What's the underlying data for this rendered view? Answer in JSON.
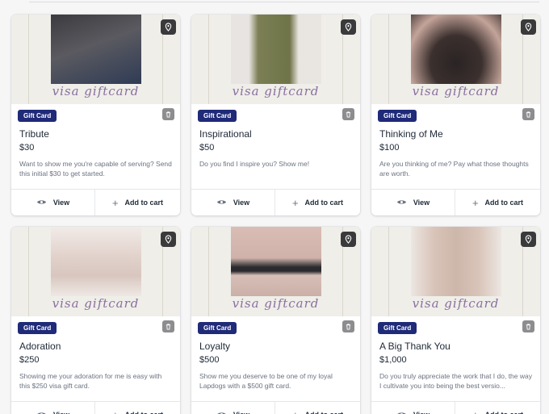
{
  "card_common": {
    "badge_label": "Gift Card",
    "view_label": "View",
    "cart_label": "Add to cart",
    "watermark_text": "visa giftcard"
  },
  "products": [
    {
      "title": "Tribute",
      "price": "$30",
      "description": "Want to show me you're capable of serving? Send this initial $30 to get started.",
      "photo_tone": "#6b6b70"
    },
    {
      "title": "Inspirational",
      "price": "$50",
      "description": "Do you find I inspire you? Show me!",
      "photo_tone": "#7c7f55"
    },
    {
      "title": "Thinking of Me",
      "price": "$100",
      "description": "Are you thinking of me? Pay what those thoughts are worth.",
      "photo_tone": "#4a3c3a"
    },
    {
      "title": "Adoration",
      "price": "$250",
      "description": "Showing me your adoration for me is easy with this $250 visa gift card.",
      "photo_tone": "#d8c6bf"
    },
    {
      "title": "Loyalty",
      "price": "$500",
      "description": "Show me you deserve to be one of my loyal Lapdogs with a $500 gift card.",
      "photo_tone": "#cfb2aa"
    },
    {
      "title": "A Big Thank You",
      "price": "$1,000",
      "description": "Do you truly appreciate the work that I do, the way I cultivate you into being the best versio...",
      "photo_tone": "#d9c4b9"
    }
  ]
}
